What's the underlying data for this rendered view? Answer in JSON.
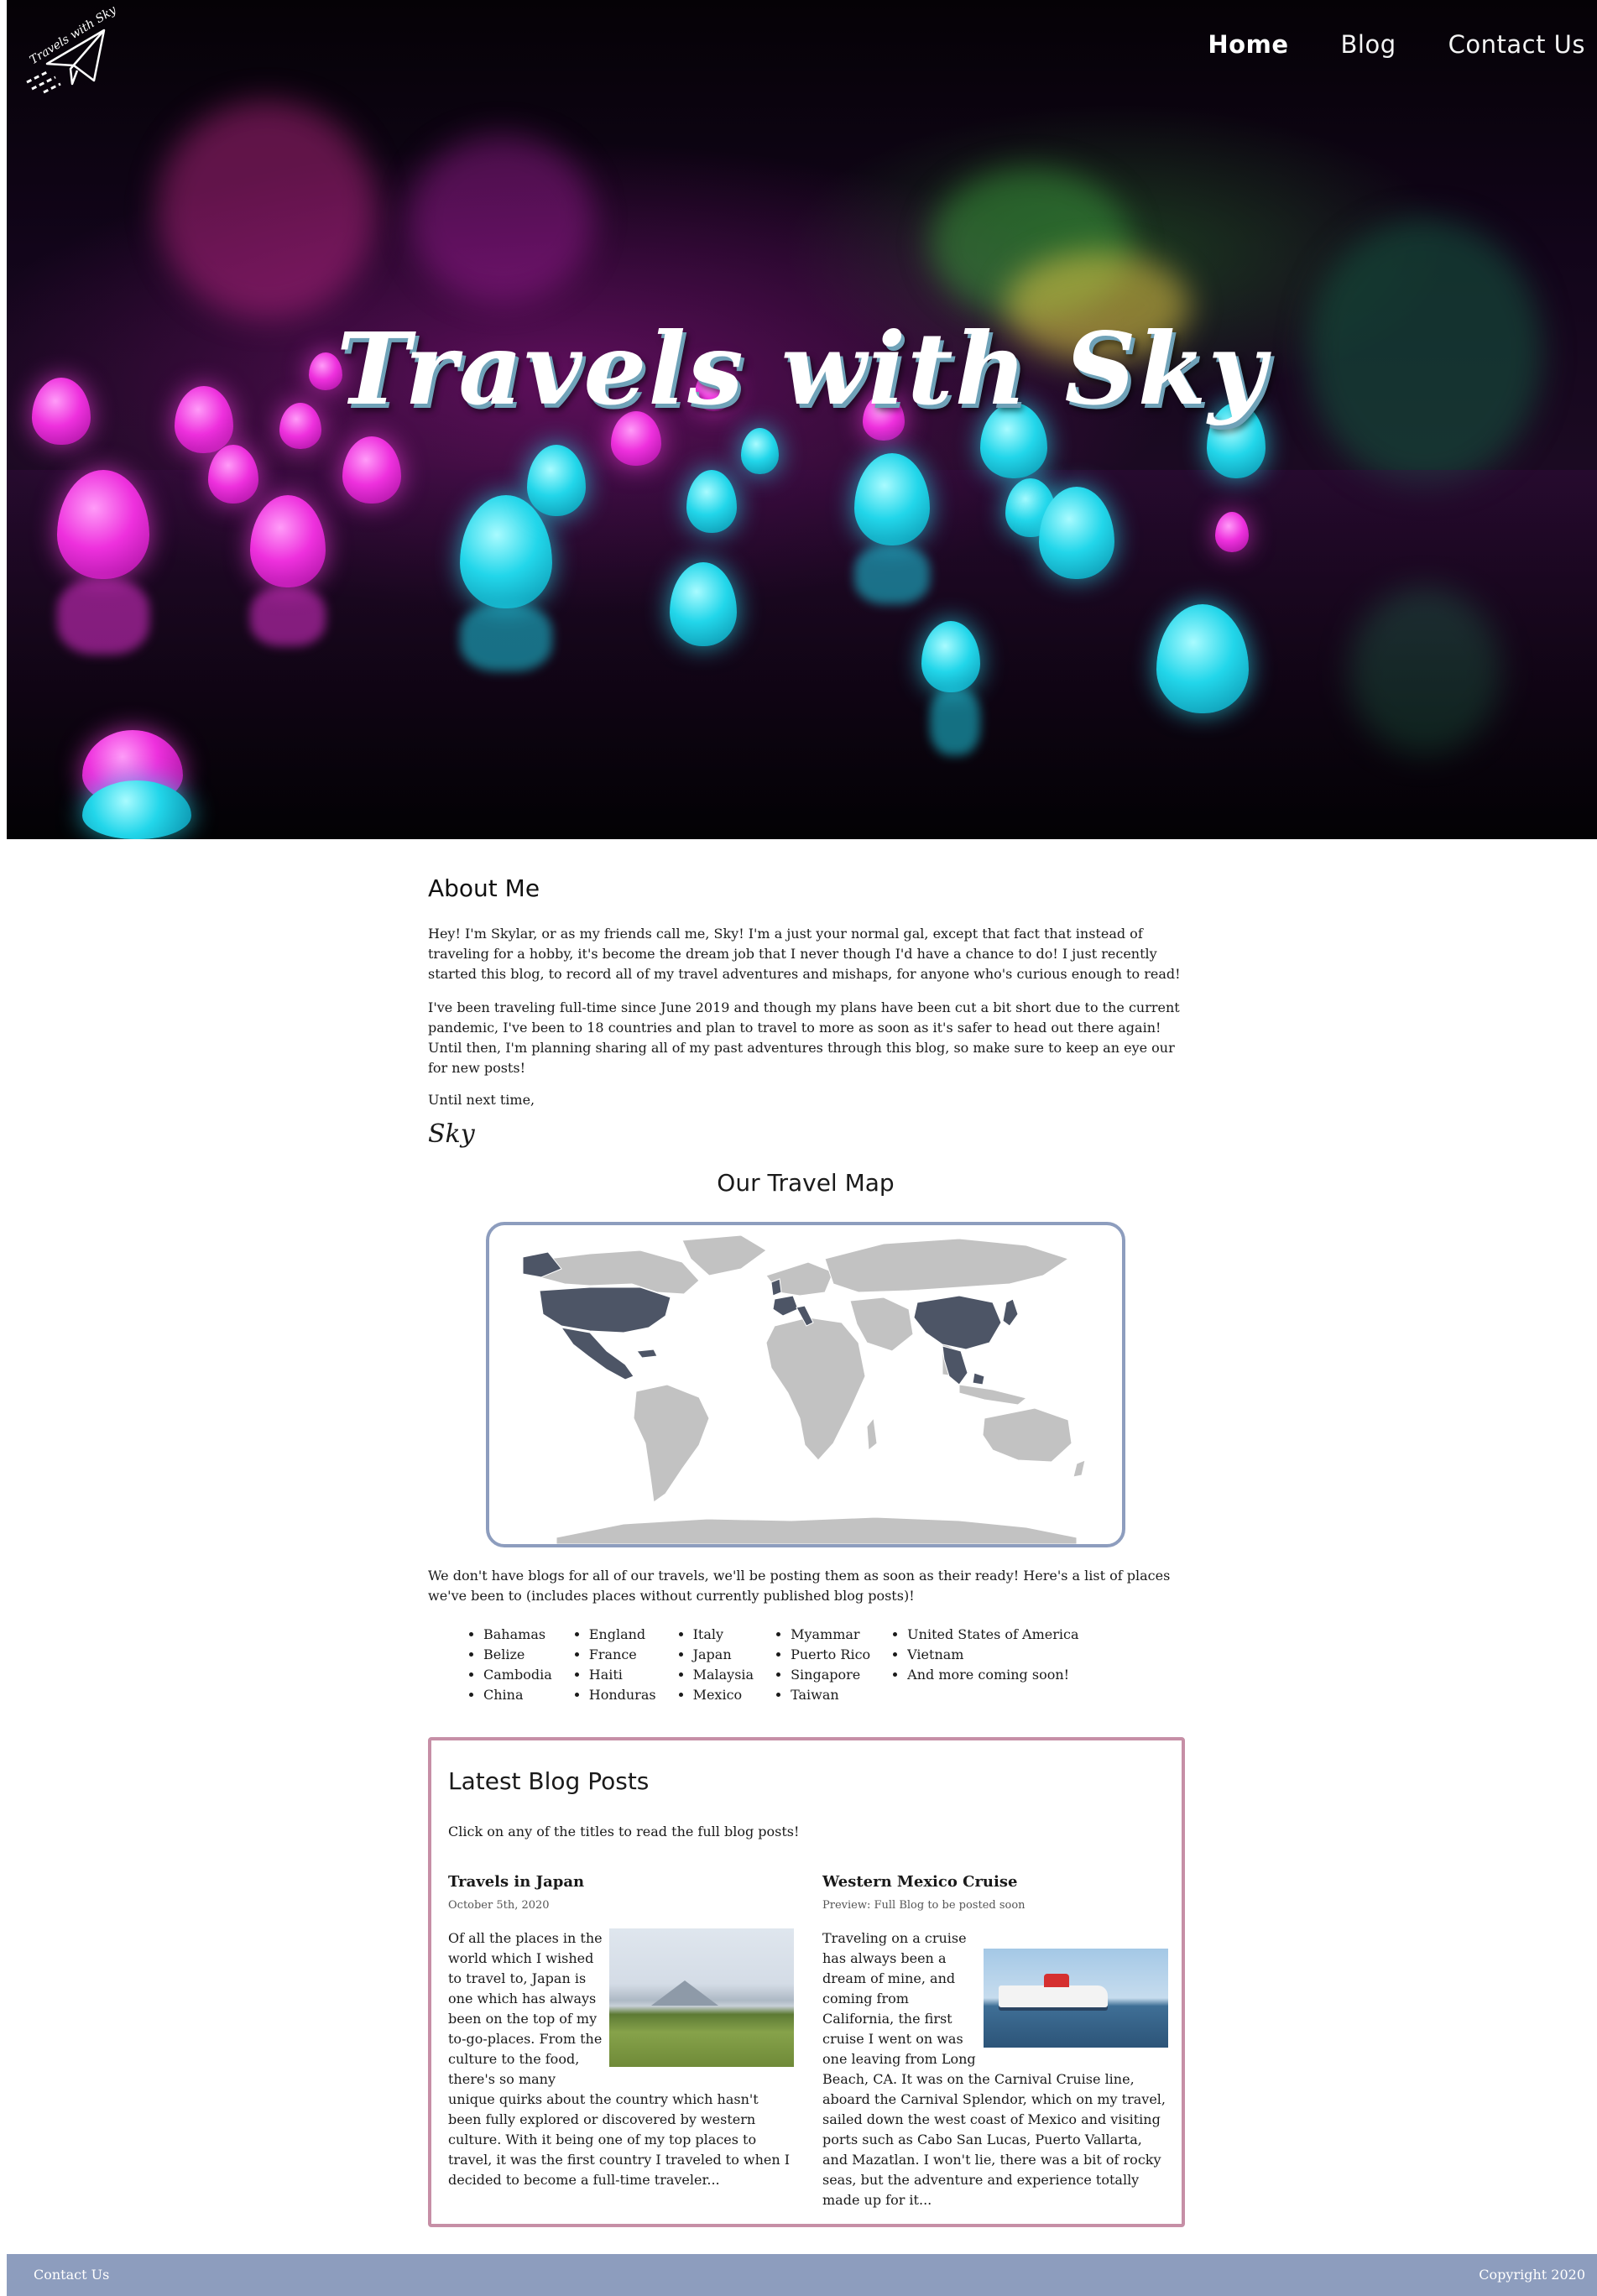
{
  "nav": {
    "logo_text": "Travels with Sky",
    "links": [
      "Home",
      "Blog",
      "Contact Us"
    ]
  },
  "hero": {
    "title": "Travels with Sky"
  },
  "about": {
    "heading": "About Me",
    "p1": "Hey! I'm Skylar, or as my friends call me, Sky! I'm a just your normal gal, except that fact that instead of traveling for a hobby, it's become the dream job that I never though I'd have a chance to do! I just recently started this blog, to record all of my travel adventures and mishaps, for anyone who's curious enough to read!",
    "p2": "I've been traveling full-time since June 2019 and though my plans have been cut a bit short due to the current pandemic, I've been to 18 countries and plan to travel to more as soon as it's safer to head out there again! Until then, I'm planning sharing all of my past adventures through this blog, so make sure to keep an eye our for new posts!",
    "signoff": "Until next time,",
    "signature": "Sky"
  },
  "map": {
    "heading": "Our Travel Map",
    "note": "We don't have blogs for all of our travels, we'll be posting them as soon as their ready! Here's a list of places we've been to (includes places without currently published blog posts)!",
    "visited_color": "#4d5566",
    "land_color": "#c2c2c2",
    "frame_color": "#8d9dbe",
    "countries": [
      [
        "Bahamas",
        "Belize",
        "Cambodia",
        "China"
      ],
      [
        "England",
        "France",
        "Haiti",
        "Honduras"
      ],
      [
        "Italy",
        "Japan",
        "Malaysia",
        "Mexico"
      ],
      [
        "Myammar",
        "Puerto Rico",
        "Singapore",
        "Taiwan"
      ],
      [
        "United States of America",
        "Vietnam",
        "And more coming soon!"
      ]
    ]
  },
  "blog": {
    "heading": "Latest Blog Posts",
    "intro": "Click on any of the titles to read the full blog posts!",
    "posts": [
      {
        "title": "Travels in Japan",
        "date": "October 5th, 2020",
        "body": "Of all the places in the world which I wished to travel to, Japan is one which has always been on the top of my to-go-places. From the culture to the food, there's so many unique quirks about the country which hasn't been fully explored or discovered by western culture. With it being one of my top places to travel, it was the first country I traveled to when I decided to become a full-time traveler..."
      },
      {
        "title": "Western Mexico Cruise",
        "date": "Preview: Full Blog to be posted soon",
        "body": "Traveling on a cruise has always been a dream of mine, and coming from California, the first cruise I went on was one leaving from Long Beach, CA. It was on the Carnival Cruise line, aboard the Carnival Splendor, which on my travel, sailed down the west coast of Mexico and visiting ports such as Cabo San Lucas, Puerto Vallarta, and Mazatlan. I won't lie, there was a bit of rocky seas, but the adventure and experience totally made up for it..."
      }
    ]
  },
  "footer": {
    "contact": "Contact Us",
    "copyright": "Copyright 2020",
    "color": "#8d9dbe"
  }
}
